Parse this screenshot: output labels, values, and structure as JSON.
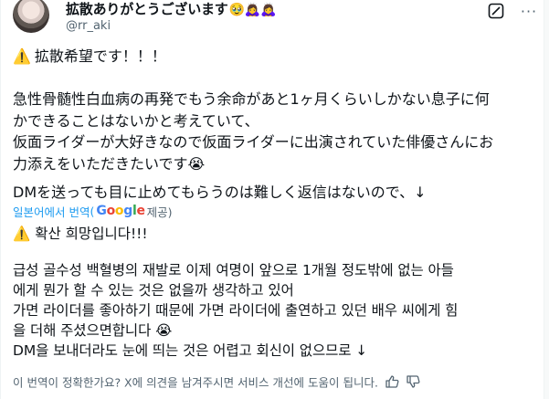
{
  "author": {
    "display_name": "拡散ありがとうございます",
    "name_emojis": "🥹🙇‍♀️🙇‍♀️",
    "handle": "@rr_aki"
  },
  "tweet": {
    "warning_emoji": "⚠️",
    "heading": "拡散希望です！！！",
    "body_lines": [
      "急性骨髄性白血病の再発でもう余命があと1ヶ月くらいしかない息子に何",
      "かできることはないかと考えていて、",
      "仮面ライダーが大好きなので仮面ライダーに出演されていた俳優さんにお",
      "力添えをいただきたいです😭"
    ],
    "dm_line": "DMを送っても目に止めてもらうのは難しく返信はないので、↓"
  },
  "translation": {
    "label": "일본어에서 번역",
    "open_paren": "(",
    "google_letters": [
      "G",
      "o",
      "o",
      "g",
      "l",
      "e"
    ],
    "suffix": " 제공)",
    "warning": "⚠️ 확산 희망입니다!!!",
    "body_lines": [
      "급성 골수성 백혈병의 재발로 이제 여명이 앞으로 1개월 정도밖에 없는 아들",
      "에게 뭔가 할 수 있는 것은 없을까 생각하고 있어",
      "가면 라이더를 좋아하기 때문에 가면 라이더에 출연하고 있던 배우 씨에게 힘",
      "을 더해 주셨으면합니다 😭",
      "DM을 보내더라도 눈에 띄는 것은 어렵고 회신이 없으므로 ↓"
    ],
    "feedback": "이 번역이 정확한가요? X에 의견을 남겨주시면 서비스 개선에 도움이 됩니다."
  },
  "colors": {
    "text": "#0f1419",
    "secondary": "#536471",
    "link": "#1d9bf0"
  },
  "icons": [
    "grok-icon",
    "more-icon",
    "thumbs-up-icon",
    "thumbs-down-icon",
    "warning-icon"
  ]
}
